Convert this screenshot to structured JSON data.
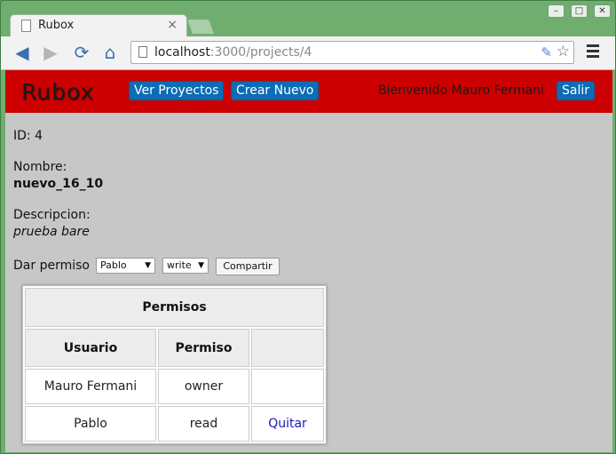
{
  "browser": {
    "tab_title": "Rubox",
    "tab_close": "×",
    "url_host": "localhost",
    "url_path": ":3000/projects/4",
    "window_controls": [
      "minimize",
      "maximize",
      "close"
    ]
  },
  "header": {
    "logo": "Rubox",
    "nav": [
      {
        "label": "Ver Proyectos"
      },
      {
        "label": "Crear Nuevo"
      }
    ],
    "welcome": "Bienvenido Mauro Fermani",
    "logout": "Salir",
    "brand_color": "#cc0000",
    "button_color": "#0b6db5"
  },
  "project": {
    "id_label": "ID: 4",
    "name_label": "Nombre:",
    "name_value": "nuevo_16_10",
    "desc_label": "Descripcion:",
    "desc_value": "prueba bare"
  },
  "permission_form": {
    "label": "Dar permiso",
    "user_selected": "Pablo",
    "perm_selected": "write",
    "submit": "Compartir"
  },
  "permissions_table": {
    "title": "Permisos",
    "headers": [
      "Usuario",
      "Permiso",
      ""
    ],
    "rows": [
      {
        "user": "Mauro Fermani",
        "perm": "owner",
        "action": ""
      },
      {
        "user": "Pablo",
        "perm": "read",
        "action": "Quitar"
      }
    ]
  }
}
